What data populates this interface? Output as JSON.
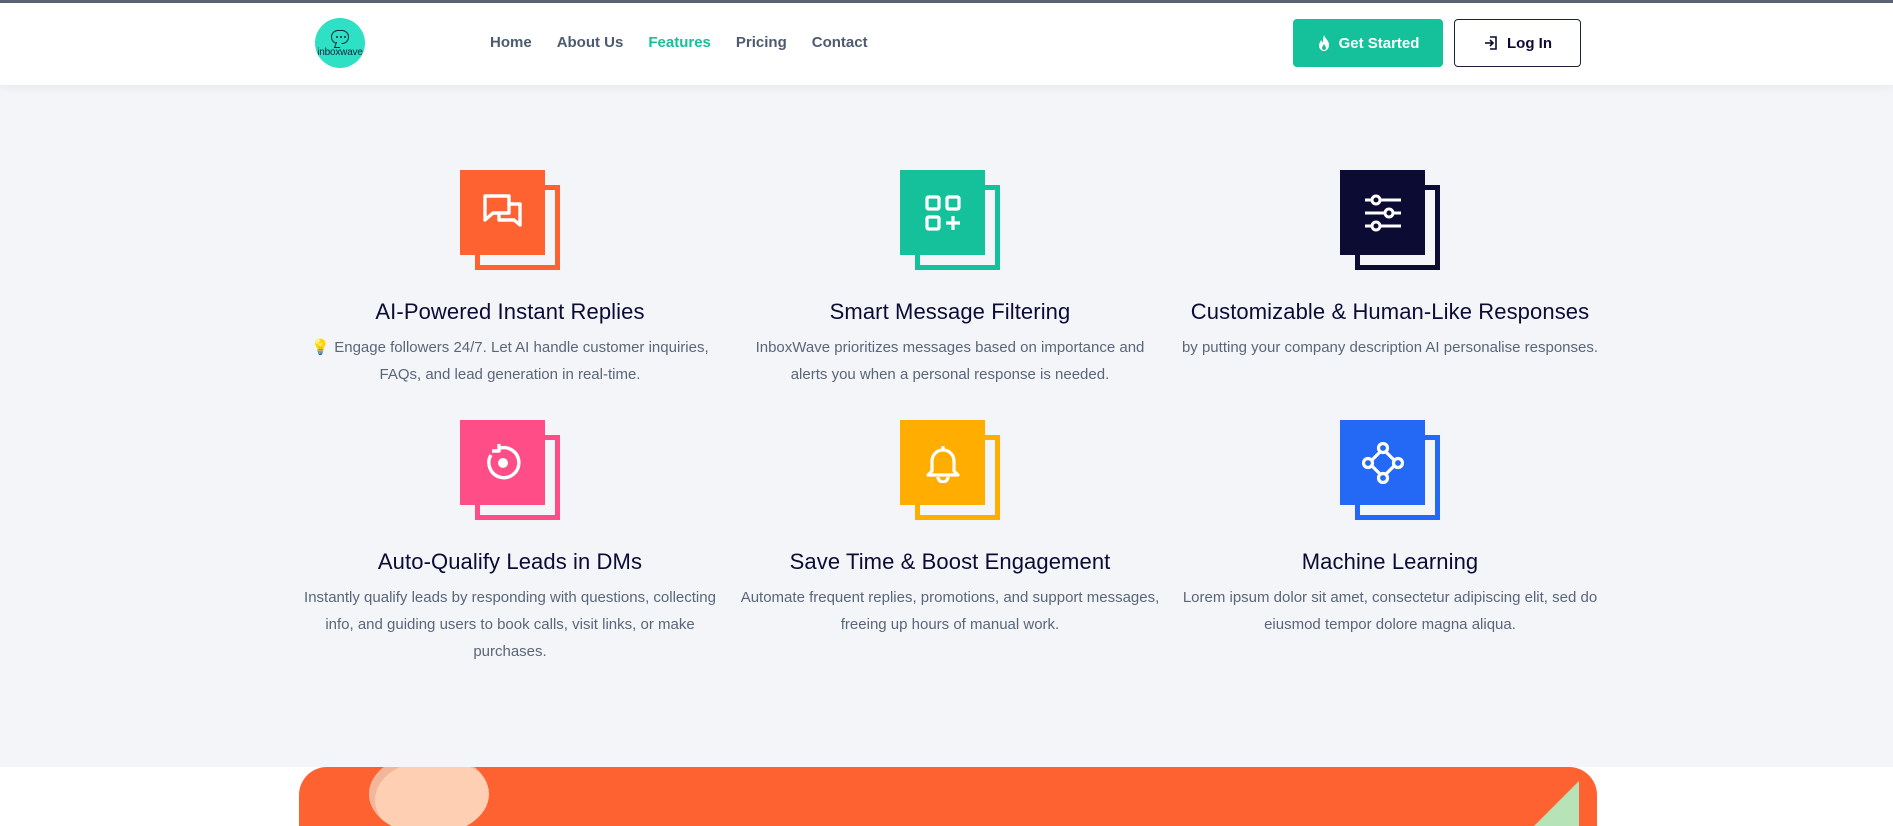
{
  "header": {
    "logo_text": "inboxwave",
    "nav": [
      "Home",
      "About Us",
      "Features",
      "Pricing",
      "Contact"
    ],
    "active_nav": "Features",
    "get_started_label": "Get Started",
    "login_label": "Log In"
  },
  "colors": {
    "accent": "#14c19a",
    "orange": "#ff6231",
    "navy": "#0b0b34",
    "pink": "#ff4d87",
    "yellow": "#ffae00",
    "blue": "#2469f6"
  },
  "features": [
    {
      "title": "AI-Powered Instant Replies",
      "desc": "💡 Engage followers 24/7. Let AI handle customer inquiries, FAQs, and lead generation in real-time.",
      "icon": "chat-bubbles-icon",
      "color": "#ff6231"
    },
    {
      "title": "Smart Message Filtering",
      "desc": "InboxWave prioritizes messages based on importance and alerts you when a personal response is needed.",
      "icon": "grid-plus-icon",
      "color": "#14c19a"
    },
    {
      "title": "Customizable & Human-Like Responses",
      "desc": "by putting your company description AI personalise responses.",
      "icon": "sliders-icon",
      "color": "#0b0b34"
    },
    {
      "title": "Auto-Qualify Leads in DMs",
      "desc": "Instantly qualify leads by responding with questions, collecting info, and guiding users to book calls, visit links, or make purchases.",
      "icon": "rotate-target-icon",
      "color": "#ff4d87"
    },
    {
      "title": "Save Time & Boost Engagement",
      "desc": "Automate frequent replies, promotions, and support messages, freeing up hours of manual work.",
      "icon": "bell-icon",
      "color": "#ffae00"
    },
    {
      "title": "Machine Learning",
      "desc": "Lorem ipsum dolor sit amet, consectetur adipiscing elit, sed do eiusmod tempor dolore magna aliqua.",
      "icon": "network-nodes-icon",
      "color": "#2469f6"
    }
  ]
}
